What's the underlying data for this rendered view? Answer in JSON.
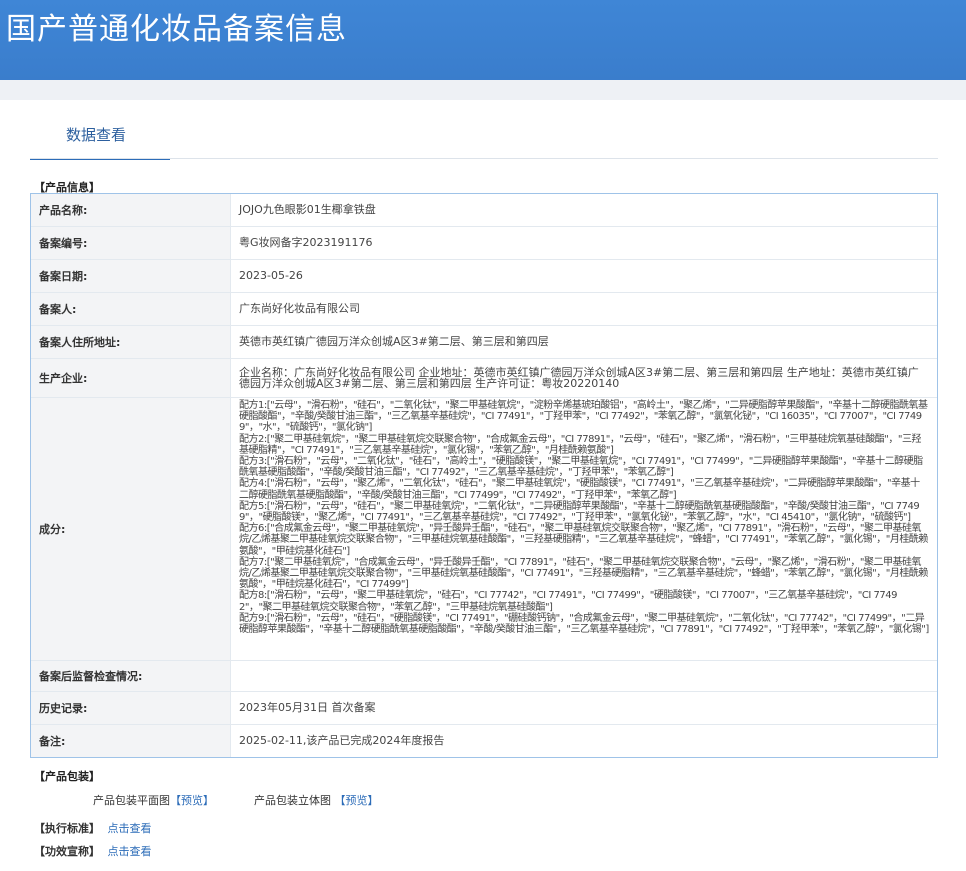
{
  "header": {
    "title": "国产普通化妆品备案信息"
  },
  "tab": {
    "label": "数据查看"
  },
  "sections": {
    "product_info": "【产品信息】",
    "packaging": "【产品包装】",
    "standard": "【执行标准】",
    "efficacy": "【功效宣称】"
  },
  "info_rows": [
    {
      "label": "产品名称:",
      "value": "JOJO九色眼影01生椰拿铁盘"
    },
    {
      "label": "备案编号:",
      "value": "粤G妆网备字2023191176"
    },
    {
      "label": "备案日期:",
      "value": "2023-05-26"
    },
    {
      "label": "备案人:",
      "value": "广东尚好化妆品有限公司"
    },
    {
      "label": "备案人住所地址:",
      "value": "英德市英红镇广德园万洋众创城A区3#第二层、第三层和第四层"
    },
    {
      "label": "生产企业:",
      "value": "企业名称：广东尚好化妆品有限公司 企业地址：英德市英红镇广德园万洋众创城A区3#第二层、第三层和第四层 生产地址：英德市英红镇广德园万洋众创城A区3#第二层、第三层和第四层 生产许可证：粤妆20220140"
    },
    {
      "label": "成分:",
      "value": "配方1:[\"云母\"，\"滑石粉\"，\"硅石\"，\"二氧化钛\"，\"聚二甲基硅氧烷\"，\"淀粉辛烯基琥珀酸铝\"，\"高岭土\"，\"聚乙烯\"，\"二异硬脂醇苹果酸酯\"，\"辛基十二醇硬脂酰氧基硬脂酸酯\"，\"辛酸/癸酸甘油三酯\"，\"三乙氧基辛基硅烷\"，\"CI 77491\"，\"丁羟甲苯\"，\"CI 77492\"，\"苯氧乙醇\"，\"氯氧化铋\"，\"CI 16035\"，\"CI 77007\"，\"CI 77499\"，\"水\"，\"硫酸钙\"，\"氯化钠\"]\n配方2:[\"聚二甲基硅氧烷\"，\"聚二甲基硅氧烷交联聚合物\"，\"合成氟金云母\"，\"CI 77891\"，\"云母\"，\"硅石\"，\"聚乙烯\"，\"滑石粉\"，\"三甲基硅烷氧基硅酸酯\"，\"三羟基硬脂精\"，\"CI 77491\"，\"三乙氧基辛基硅烷\"，\"氯化锡\"，\"苯氧乙醇\"，\"月桂酰赖氨酸\"]\n配方3:[\"滑石粉\"，\"云母\"，\"二氧化钛\"，\"硅石\"，\"高岭土\"，\"硬脂酸镁\"，\"聚二甲基硅氧烷\"，\"CI 77491\"，\"CI 77499\"，\"二异硬脂醇苹果酸酯\"，\"辛基十二醇硬脂酰氧基硬脂酸酯\"，\"辛酸/癸酸甘油三酯\"，\"CI 77492\"，\"三乙氧基辛基硅烷\"，\"丁羟甲苯\"，\"苯氧乙醇\"]\n配方4:[\"滑石粉\"，\"云母\"，\"聚乙烯\"，\"二氧化钛\"，\"硅石\"，\"聚二甲基硅氧烷\"，\"硬脂酸镁\"，\"CI 77491\"，\"三乙氧基辛基硅烷\"，\"二异硬脂醇苹果酸酯\"，\"辛基十二醇硬脂酰氧基硬脂酸酯\"，\"辛酸/癸酸甘油三酯\"，\"CI 77499\"，\"CI 77492\"，\"丁羟甲苯\"，\"苯氧乙醇\"]\n配方5:[\"滑石粉\"，\"云母\"，\"硅石\"，\"聚二甲基硅氧烷\"，\"二氧化钛\"，\"二异硬脂醇苹果酸酯\"，\"辛基十二醇硬脂酰氧基硬脂酸酯\"，\"辛酸/癸酸甘油三酯\"，\"CI 77499\"，\"硬脂酸镁\"，\"聚乙烯\"，\"CI 77491\"，\"三乙氧基辛基硅烷\"，\"CI 77492\"，\"丁羟甲苯\"，\"氯氧化铋\"，\"苯氧乙醇\"，\"水\"，\"CI 45410\"，\"氯化钠\"，\"硫酸钙\"]\n配方6:[\"合成氟金云母\"，\"聚二甲基硅氧烷\"，\"异壬酸异壬酯\"，\"硅石\"，\"聚二甲基硅氧烷交联聚合物\"，\"聚乙烯\"，\"CI 77891\"，\"滑石粉\"，\"云母\"，\"聚二甲基硅氧烷/乙烯基聚二甲基硅氧烷交联聚合物\"，\"三甲基硅烷氧基硅酸酯\"，\"三羟基硬脂精\"，\"三乙氧基辛基硅烷\"，\"蜂蜡\"，\"CI 77491\"，\"苯氧乙醇\"，\"氯化锡\"，\"月桂酰赖氨酸\"，\"甲硅烷基化硅石\"]\n配方7:[\"聚二甲基硅氧烷\"，\"合成氟金云母\"，\"异壬酸异壬酯\"，\"CI 77891\"，\"硅石\"，\"聚二甲基硅氧烷交联聚合物\"，\"云母\"，\"聚乙烯\"，\"滑石粉\"，\"聚二甲基硅氧烷/乙烯基聚二甲基硅氧烷交联聚合物\"，\"三甲基硅烷氧基硅酸酯\"，\"CI 77491\"，\"三羟基硬脂精\"，\"三乙氧基辛基硅烷\"，\"蜂蜡\"，\"苯氧乙醇\"，\"氯化锡\"，\"月桂酰赖氨酸\"，\"甲硅烷基化硅石\"，\"CI 77499\"]\n配方8:[\"滑石粉\"，\"云母\"，\"聚二甲基硅氧烷\"，\"硅石\"，\"CI 77742\"，\"CI 77491\"，\"CI 77499\"，\"硬脂酸镁\"，\"CI 77007\"，\"三乙氧基辛基硅烷\"，\"CI 77492\"，\"聚二甲基硅氧烷交联聚合物\"，\"苯氧乙醇\"，\"三甲基硅烷氧基硅酸酯\"]\n配方9:[\"滑石粉\"，\"云母\"，\"硅石\"，\"硬脂酸镁\"，\"CI 77491\"，\"硼硅酸钙钠\"，\"合成氟金云母\"，\"聚二甲基硅氧烷\"，\"二氧化钛\"，\"CI 77742\"，\"CI 77499\"，\"二异硬脂醇苹果酸酯\"，\"辛基十二醇硬脂酰氧基硬脂酸酯\"，\"辛酸/癸酸甘油三酯\"，\"三乙氧基辛基硅烷\"，\"CI 77891\"，\"CI 77492\"，\"丁羟甲苯\"，\"苯氧乙醇\"，\"氯化锡\"]"
    },
    {
      "label": "备案后监督检查情况:",
      "value": ""
    },
    {
      "label": "历史记录:",
      "value": "2023年05月31日 首次备案"
    },
    {
      "label": "备注:",
      "value": "2025-02-11,该产品已完成2024年度报告"
    }
  ],
  "packaging": {
    "flat_label": "产品包装平面图",
    "flat_preview": "【预览】",
    "solid_label": "产品包装立体图",
    "solid_preview": "【预览】"
  },
  "links": {
    "standard_link": "点击查看",
    "efficacy_link": "点击查看"
  },
  "colors": {
    "header_bg": "#3a7dcc",
    "link": "#2c6cb8",
    "table_border": "#9fc3e8"
  }
}
